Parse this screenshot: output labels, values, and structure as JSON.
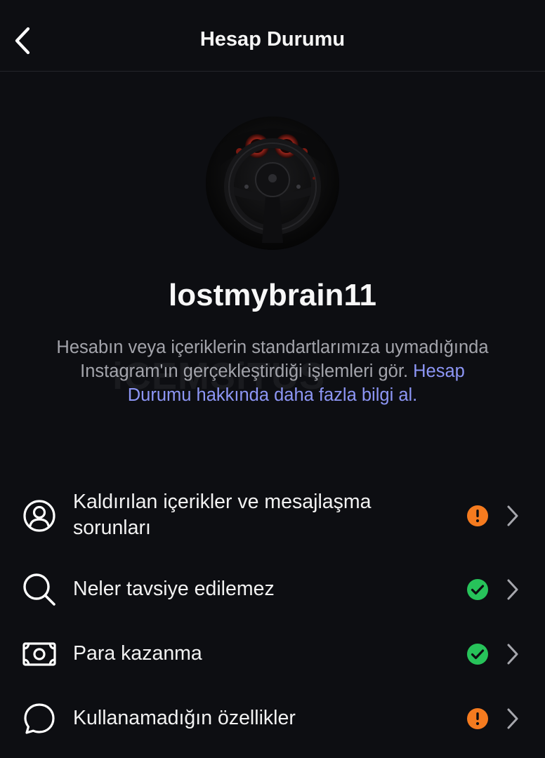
{
  "header": {
    "title": "Hesap Durumu"
  },
  "profile": {
    "username": "lostmybrain11"
  },
  "description": {
    "text": "Hesabın veya içeriklerin standartlarımıza uymadığında Instagram'ın gerçekleştirdiği işlemleri gör. ",
    "link": "Hesap Durumu hakkında daha fazla bilgi al."
  },
  "watermark": {
    "text": "iCEMSiTUS"
  },
  "menu": {
    "items": [
      {
        "label": "Kaldırılan içerikler ve mesajlaşma sorunları",
        "icon": "user-circle-icon",
        "status": "warning"
      },
      {
        "label": "Neler tavsiye edilemez",
        "icon": "search-icon",
        "status": "ok"
      },
      {
        "label": "Para kazanma",
        "icon": "money-icon",
        "status": "ok"
      },
      {
        "label": "Kullanamadığın özellikler",
        "icon": "chat-bubble-icon",
        "status": "warning"
      }
    ]
  },
  "colors": {
    "background": "#0d0e12",
    "warning": "#f57b1f",
    "ok": "#27c35a",
    "link": "#8d96f5",
    "secondary_text": "#a3a4ab"
  }
}
